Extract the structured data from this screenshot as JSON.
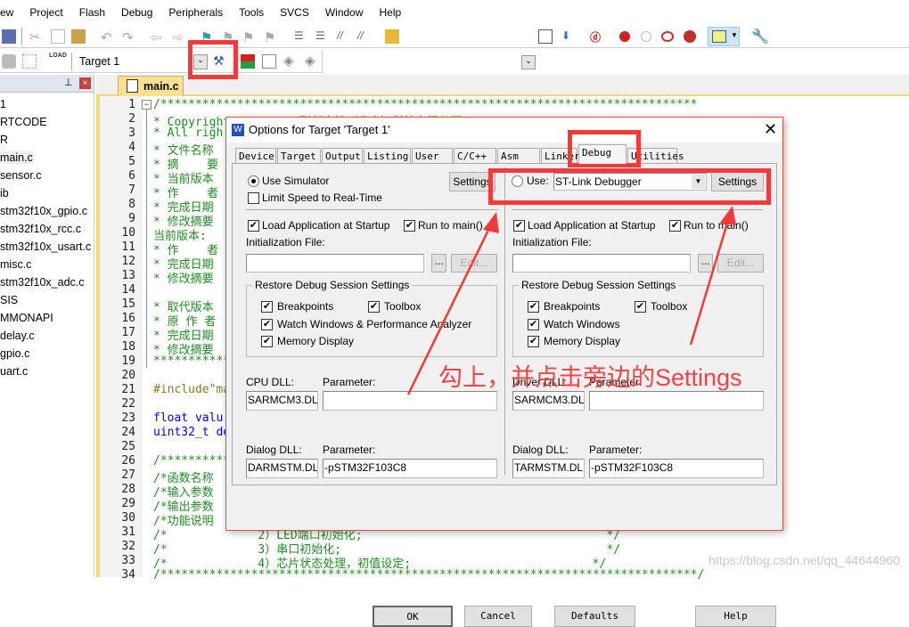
{
  "menu": [
    "ew",
    "Project",
    "Flash",
    "Debug",
    "Peripherals",
    "Tools",
    "SVCS",
    "Window",
    "Help"
  ],
  "toolbar": {
    "target": "Target 1",
    "load_label": "LOAD"
  },
  "project_tree": [
    "1",
    "RTCODE",
    "R",
    "main.c",
    "sensor.c",
    "ib",
    "stm32f10x_gpio.c",
    "stm32f10x_rcc.c",
    "stm32f10x_usart.c",
    "misc.c",
    "stm32f10x_adc.c",
    "SIS",
    "MMONAPI",
    "delay.c",
    "gpio.c",
    "uart.c"
  ],
  "editor": {
    "tab": "main.c",
    "lines": [
      "/*****************************************************************************",
      "* Copyright (c) 2015 联创中控（北京）科技有限公司",
      "* All righ",
      "* 文件名称",
      "* 摘    要",
      "* 当前版本",
      "* 作    者",
      "* 完成日期",
      "* 修改摘要",
      "当前版本: ",
      "* 作    者",
      "* 完成日期",
      "* 修改摘要",
      "",
      "* 取代版本",
      "* 原 作 者",
      "* 完成日期",
      "* 修改摘要",
      "**************",
      "",
      "#include\"ma",
      "",
      "float valu",
      "uint32_t de",
      "",
      "/**********",
      "/*函数名称",
      "/*输入参数",
      "/*输出参数",
      "/*功能说明",
      "/*             2）LED端口初始化;                                   */",
      "/*             3）串口初始化;                                      */",
      "/*             4）芯片状态处理，初值设定;                          */",
      "/*****************************************************************************/"
    ]
  },
  "dialog": {
    "title": "Options for Target 'Target 1'",
    "tabs": [
      "Device",
      "Target",
      "Output",
      "Listing",
      "User",
      "C/C++",
      "Asm",
      "Linker",
      "Debug",
      "Utilities"
    ],
    "active_tab": "Debug",
    "left": {
      "use_simulator": "Use Simulator",
      "limit_speed": "Limit Speed to Real-Time",
      "settings": "Settings",
      "load_app": "Load Application at Startup",
      "run_main": "Run to main()",
      "init_file": "Initialization File:",
      "browse": "...",
      "edit": "Edit...",
      "restore_group": "Restore Debug Session Settings",
      "breakpoints": "Breakpoints",
      "toolbox": "Toolbox",
      "watch": "Watch Windows & Performance Analyzer",
      "memory": "Memory Display",
      "cpu_dll": "CPU DLL:",
      "cpu_dll_value": "SARMCM3.DLL",
      "parameter": "Parameter:",
      "cpu_param": "",
      "dialog_dll": "Dialog DLL:",
      "dialog_dll_value": "DARMSTM.DLL",
      "dialog_param": "-pSTM32F103C8"
    },
    "right": {
      "use": "Use:",
      "debugger": "ST-Link Debugger",
      "settings": "Settings",
      "load_app": "Load Application at Startup",
      "run_main": "Run to main()",
      "init_file": "Initialization File:",
      "browse": "...",
      "edit": "Edit...",
      "restore_group": "Restore Debug Session Settings",
      "breakpoints": "Breakpoints",
      "toolbox": "Toolbox",
      "watch": "Watch Windows",
      "memory": "Memory Display",
      "driver_dll": "Driver DLL:",
      "driver_dll_value": "SARMCM3.DLL",
      "parameter": "Parameter:",
      "driver_param": "",
      "dialog_dll": "Dialog DLL:",
      "dialog_dll_value": "TARMSTM.DLL",
      "dialog_param": "-pSTM32F103C8"
    },
    "buttons": {
      "ok": "OK",
      "cancel": "Cancel",
      "defaults": "Defaults",
      "help": "Help"
    }
  },
  "annotation": "勾上，并点击旁边的Settings",
  "watermark": "https://blog.csdn.net/qq_44644960",
  "colors": {
    "annotation": "#f23a3a",
    "tab_accent": "#fbe08f"
  }
}
